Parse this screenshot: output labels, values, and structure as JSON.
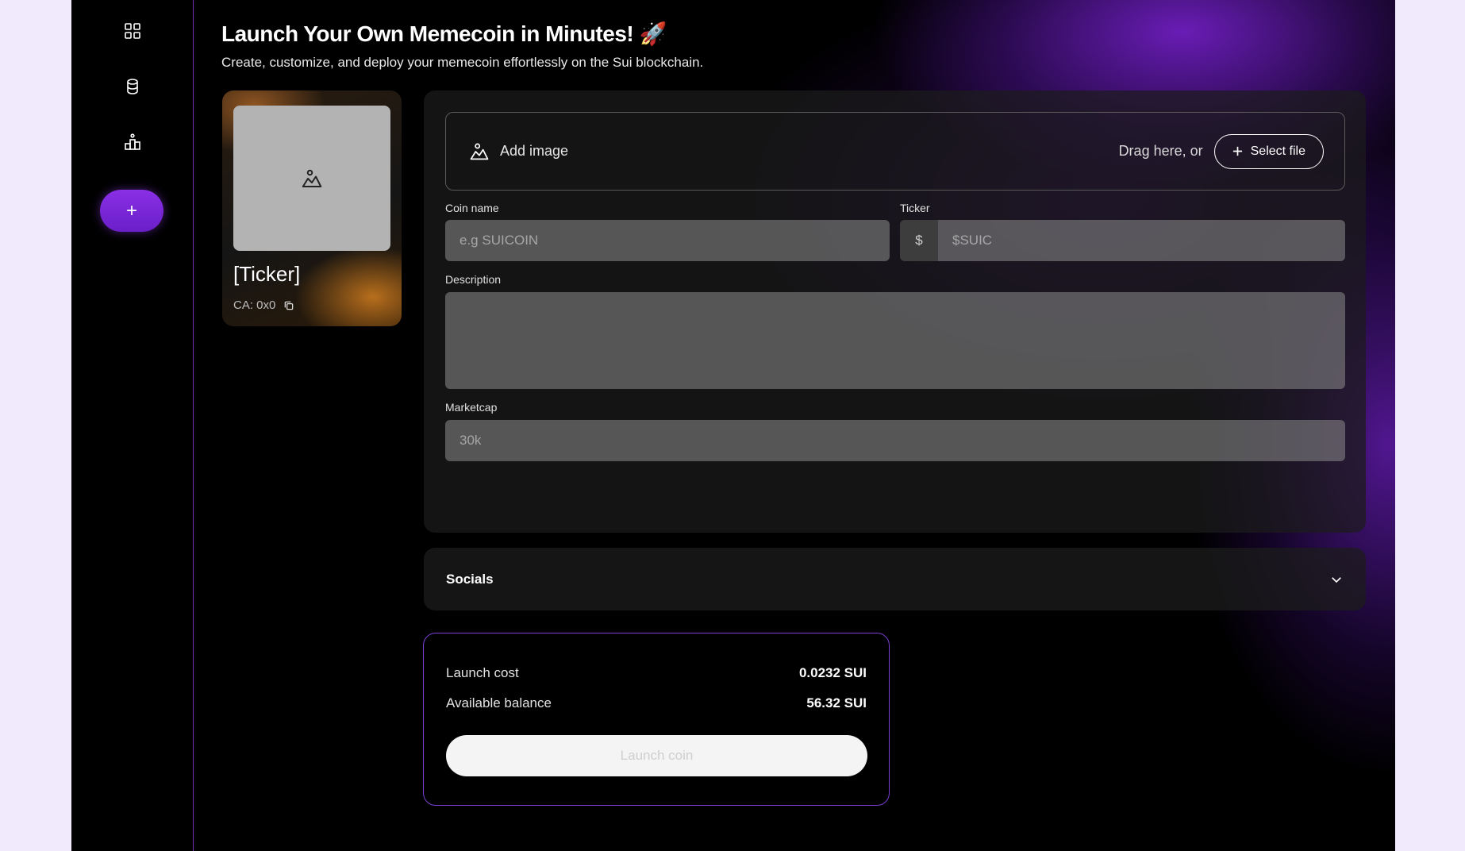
{
  "header": {
    "title": "Launch Your Own Memecoin in Minutes! 🚀",
    "subtitle": "Create, customize, and deploy your memecoin effortlessly on the Sui blockchain."
  },
  "sidebar": {
    "items": [
      {
        "icon": "grid-icon"
      },
      {
        "icon": "coin-stack-icon"
      },
      {
        "icon": "leaderboard-icon"
      }
    ],
    "create_label": "+"
  },
  "preview": {
    "ticker": "[Ticker]",
    "ca": "CA: 0x0"
  },
  "form": {
    "add_image_label": "Add image",
    "drag_text": "Drag here, or",
    "select_file_label": "Select file",
    "coin_name_label": "Coin name",
    "coin_name_placeholder": "e.g SUICOIN",
    "ticker_label": "Ticker",
    "ticker_prefix": "$",
    "ticker_placeholder": "$SUIC",
    "description_label": "Description",
    "description_placeholder": "",
    "marketcap_label": "Marketcap",
    "marketcap_placeholder": "30k"
  },
  "socials": {
    "title": "Socials"
  },
  "launch": {
    "cost_label": "Launch cost",
    "cost_value": "0.0232 SUI",
    "balance_label": "Available balance",
    "balance_value": "56.32 SUI",
    "button_label": "Launch coin"
  },
  "colors": {
    "accent": "#7c2ae0",
    "background": "#000000",
    "page_bg": "#f1e9fc"
  }
}
